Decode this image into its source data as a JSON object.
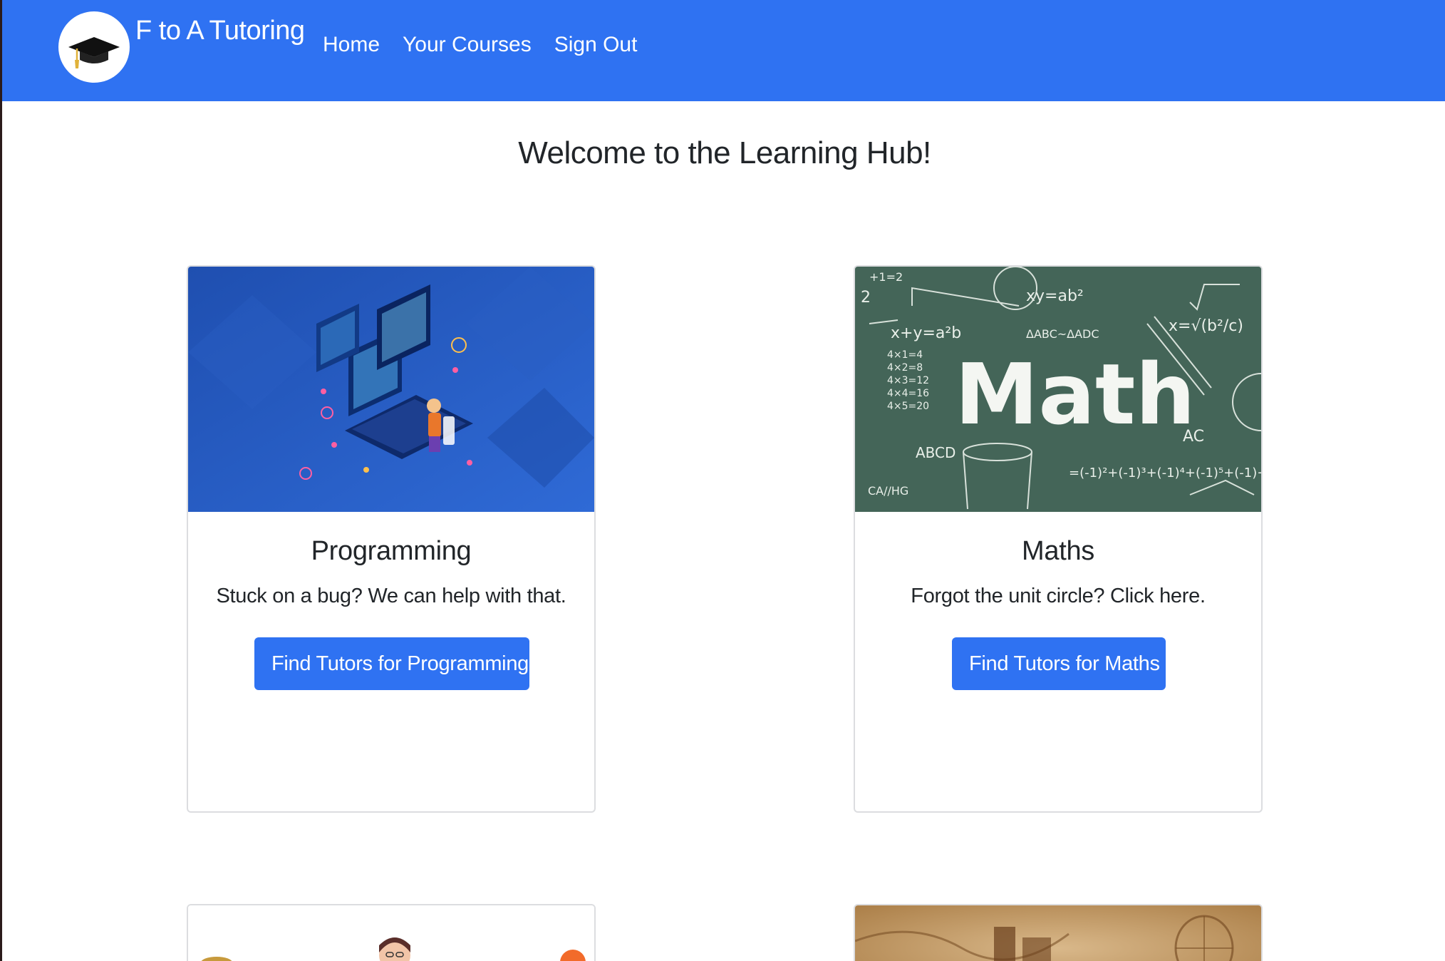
{
  "navbar": {
    "brand": "F to A Tutoring",
    "logo_icon": "graduation-cap-icon",
    "links": [
      {
        "label": "Home"
      },
      {
        "label": "Your Courses"
      },
      {
        "label": "Sign Out"
      }
    ],
    "bg_color": "#2f72f2"
  },
  "main": {
    "title": "Welcome to the Learning Hub!"
  },
  "cards": [
    {
      "image": "programming-isometric-illustration",
      "title": "Programming",
      "text": "Stuck on a bug? We can help with that.",
      "button": "Find Tutors for Programming"
    },
    {
      "image": "math-chalkboard",
      "title": "Maths",
      "text": "Forgot the unit circle? Click here.",
      "button": "Find Tutors for Maths"
    },
    {
      "image": "people-illustration-partial"
    },
    {
      "image": "vintage-map-partial"
    }
  ],
  "colors": {
    "primary": "#2f72f2",
    "text": "#212529",
    "card_border": "#dcdde0"
  }
}
